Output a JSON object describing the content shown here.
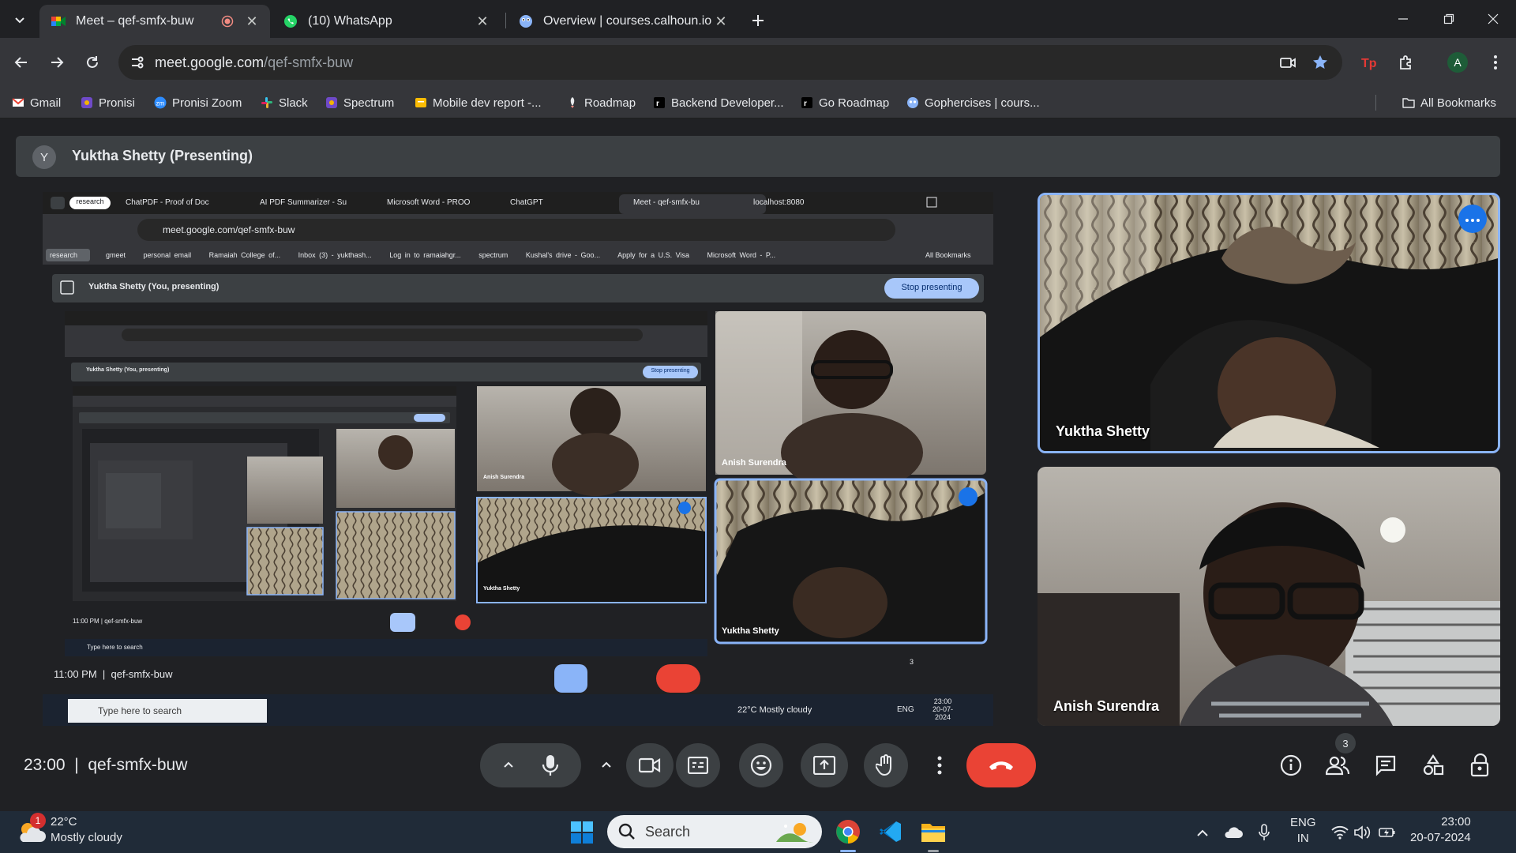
{
  "browser": {
    "tabs": [
      {
        "title": "Meet – qef-smfx-buw",
        "active": true
      },
      {
        "title": "(10) WhatsApp",
        "active": false
      },
      {
        "title": "Overview | courses.calhoun.io",
        "active": false
      }
    ],
    "url_host": "meet.google.com",
    "url_path": "/qef-smfx-buw",
    "profile_initial": "A",
    "bookmarks": [
      "Gmail",
      "Pronisi",
      "Pronisi Zoom",
      "Slack",
      "Spectrum",
      "Mobile dev report -...",
      "Roadmap",
      "Backend Developer...",
      "Go Roadmap",
      "Gophercises | cours..."
    ],
    "all_bookmarks": "All Bookmarks"
  },
  "meet": {
    "presenter_initial": "Y",
    "presenter_label": "Yuktha Shetty (Presenting)",
    "shared_screen": {
      "tabs": [
        "research",
        "ChatPDF - Proof of Doc",
        "AI PDF Summarizer - Su",
        "Microsoft Word - PROO",
        "ChatGPT",
        "Meet - qef-smfx-bu",
        "localhost:8080"
      ],
      "url": "meet.google.com/qef-smfx-buw",
      "bookmarks": [
        "research",
        "gmeet",
        "personal email",
        "Ramaiah College of...",
        "Inbox (3) - yukthash...",
        "Log in to ramaiahgr...",
        "spectrum",
        "Kushal's drive - Goo...",
        "Apply for a U.S. Visa",
        "Microsoft Word - P..."
      ],
      "all_bookmarks": "All Bookmarks",
      "banner": "Yuktha Shetty (You, presenting)",
      "stop_presenting": "Stop presenting",
      "nested_banner": "Yuktha Shetty (You, presenting)",
      "nested_stop": "Stop presenting",
      "tile_names": [
        "Anish Surendra",
        "Yuktha Shetty"
      ],
      "inner_tile_names": [
        "Anish Surendra",
        "Yuktha Shetty"
      ],
      "time": "11:00 PM",
      "code": "qef-smfx-buw",
      "inner_time": "11:00 PM",
      "inner_code": "qef-smfx-buw",
      "people_count": "3",
      "taskbar_search": "Type here to search",
      "inner_search": "Type here to search",
      "weather": "22°C  Mostly cloudy",
      "lang": "ENG",
      "clock_time": "23:00",
      "clock_date": "20-07-2024"
    },
    "participants": [
      {
        "name": "Yuktha Shetty"
      },
      {
        "name": "Anish Surendra"
      }
    ],
    "time": "23:00",
    "code": "qef-smfx-buw",
    "people_count": "3"
  },
  "taskbar": {
    "weather_badge": "1",
    "temperature": "22°C",
    "weather": "Mostly cloudy",
    "search": "Search",
    "lang": "ENG",
    "region": "IN",
    "time": "23:00",
    "date": "20-07-2024"
  },
  "colors": {
    "end_call": "#ea4335",
    "accent": "#8ab4f8",
    "active_present": "#8ab4f8",
    "tab_bg": "#35363a",
    "frame": "#202124"
  }
}
